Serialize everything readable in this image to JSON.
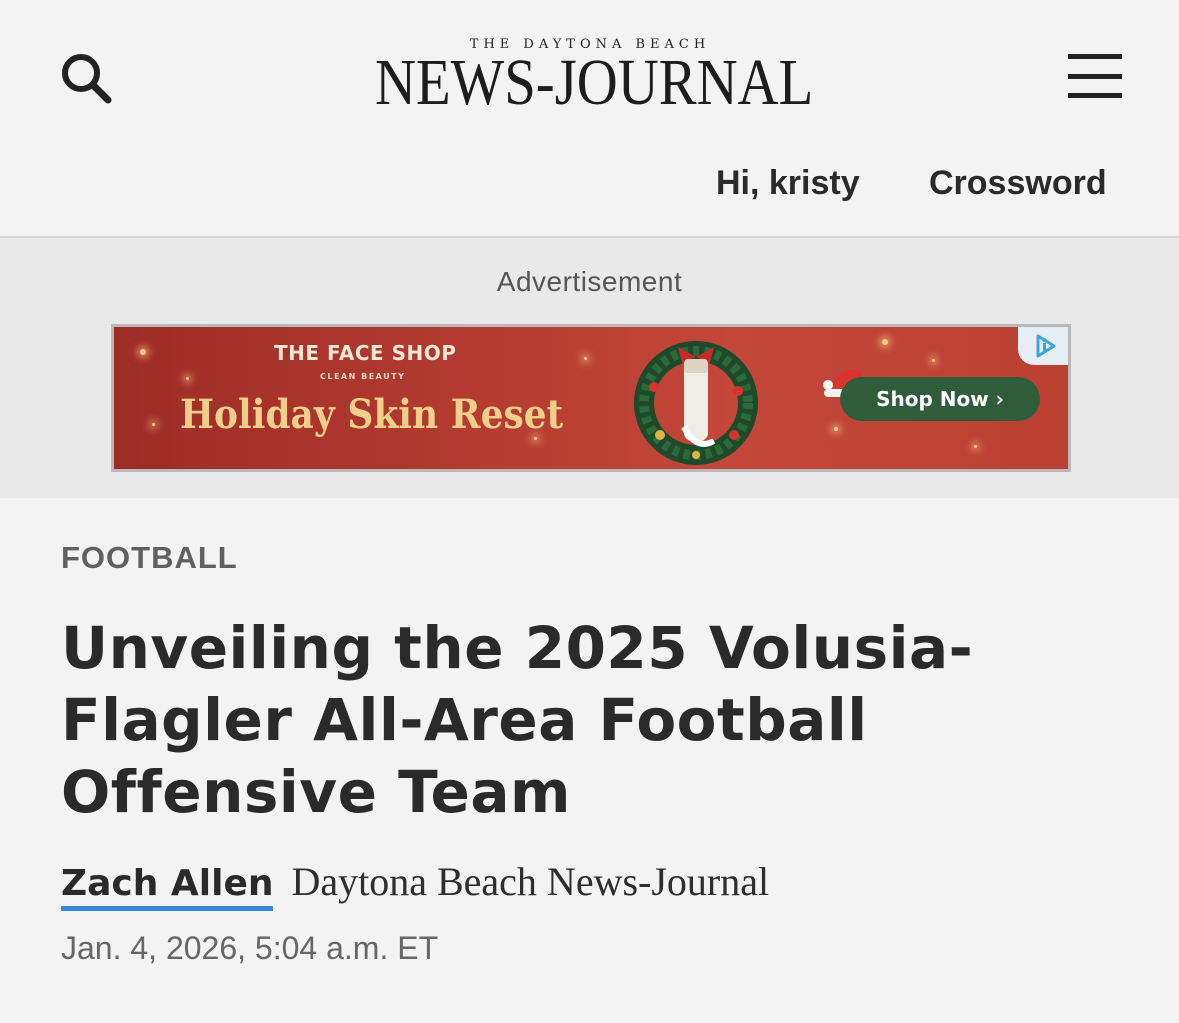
{
  "header": {
    "logo_kicker": "THE DAYTONA BEACH",
    "logo_name": "NEWS-JOURNAL",
    "greeting": "Hi, kristy",
    "crossword_link": "Crossword",
    "search_icon": "search-icon",
    "menu_icon": "hamburger-menu-icon"
  },
  "ad": {
    "label": "Advertisement",
    "brand_name": "THE FACE SHOP",
    "brand_tagline": "CLEAN BEAUTY",
    "headline": "Holiday Skin Reset",
    "cta": "Shop Now ›",
    "adchoices_icon": "adchoices-icon",
    "colors": {
      "background": "#b23a2f",
      "headline": "#f0cf8a",
      "cta_background": "#2f5c3a"
    }
  },
  "article": {
    "section": "FOOTBALL",
    "headline": "Unveiling the 2025 Volusia-Flagler All-Area Football Offensive Team",
    "author": "Zach Allen",
    "publication": "Daytona Beach News-Journal",
    "date": "Jan. 4, 2026, 5:04 a.m. ET",
    "accent_color": "#3b86d6"
  }
}
